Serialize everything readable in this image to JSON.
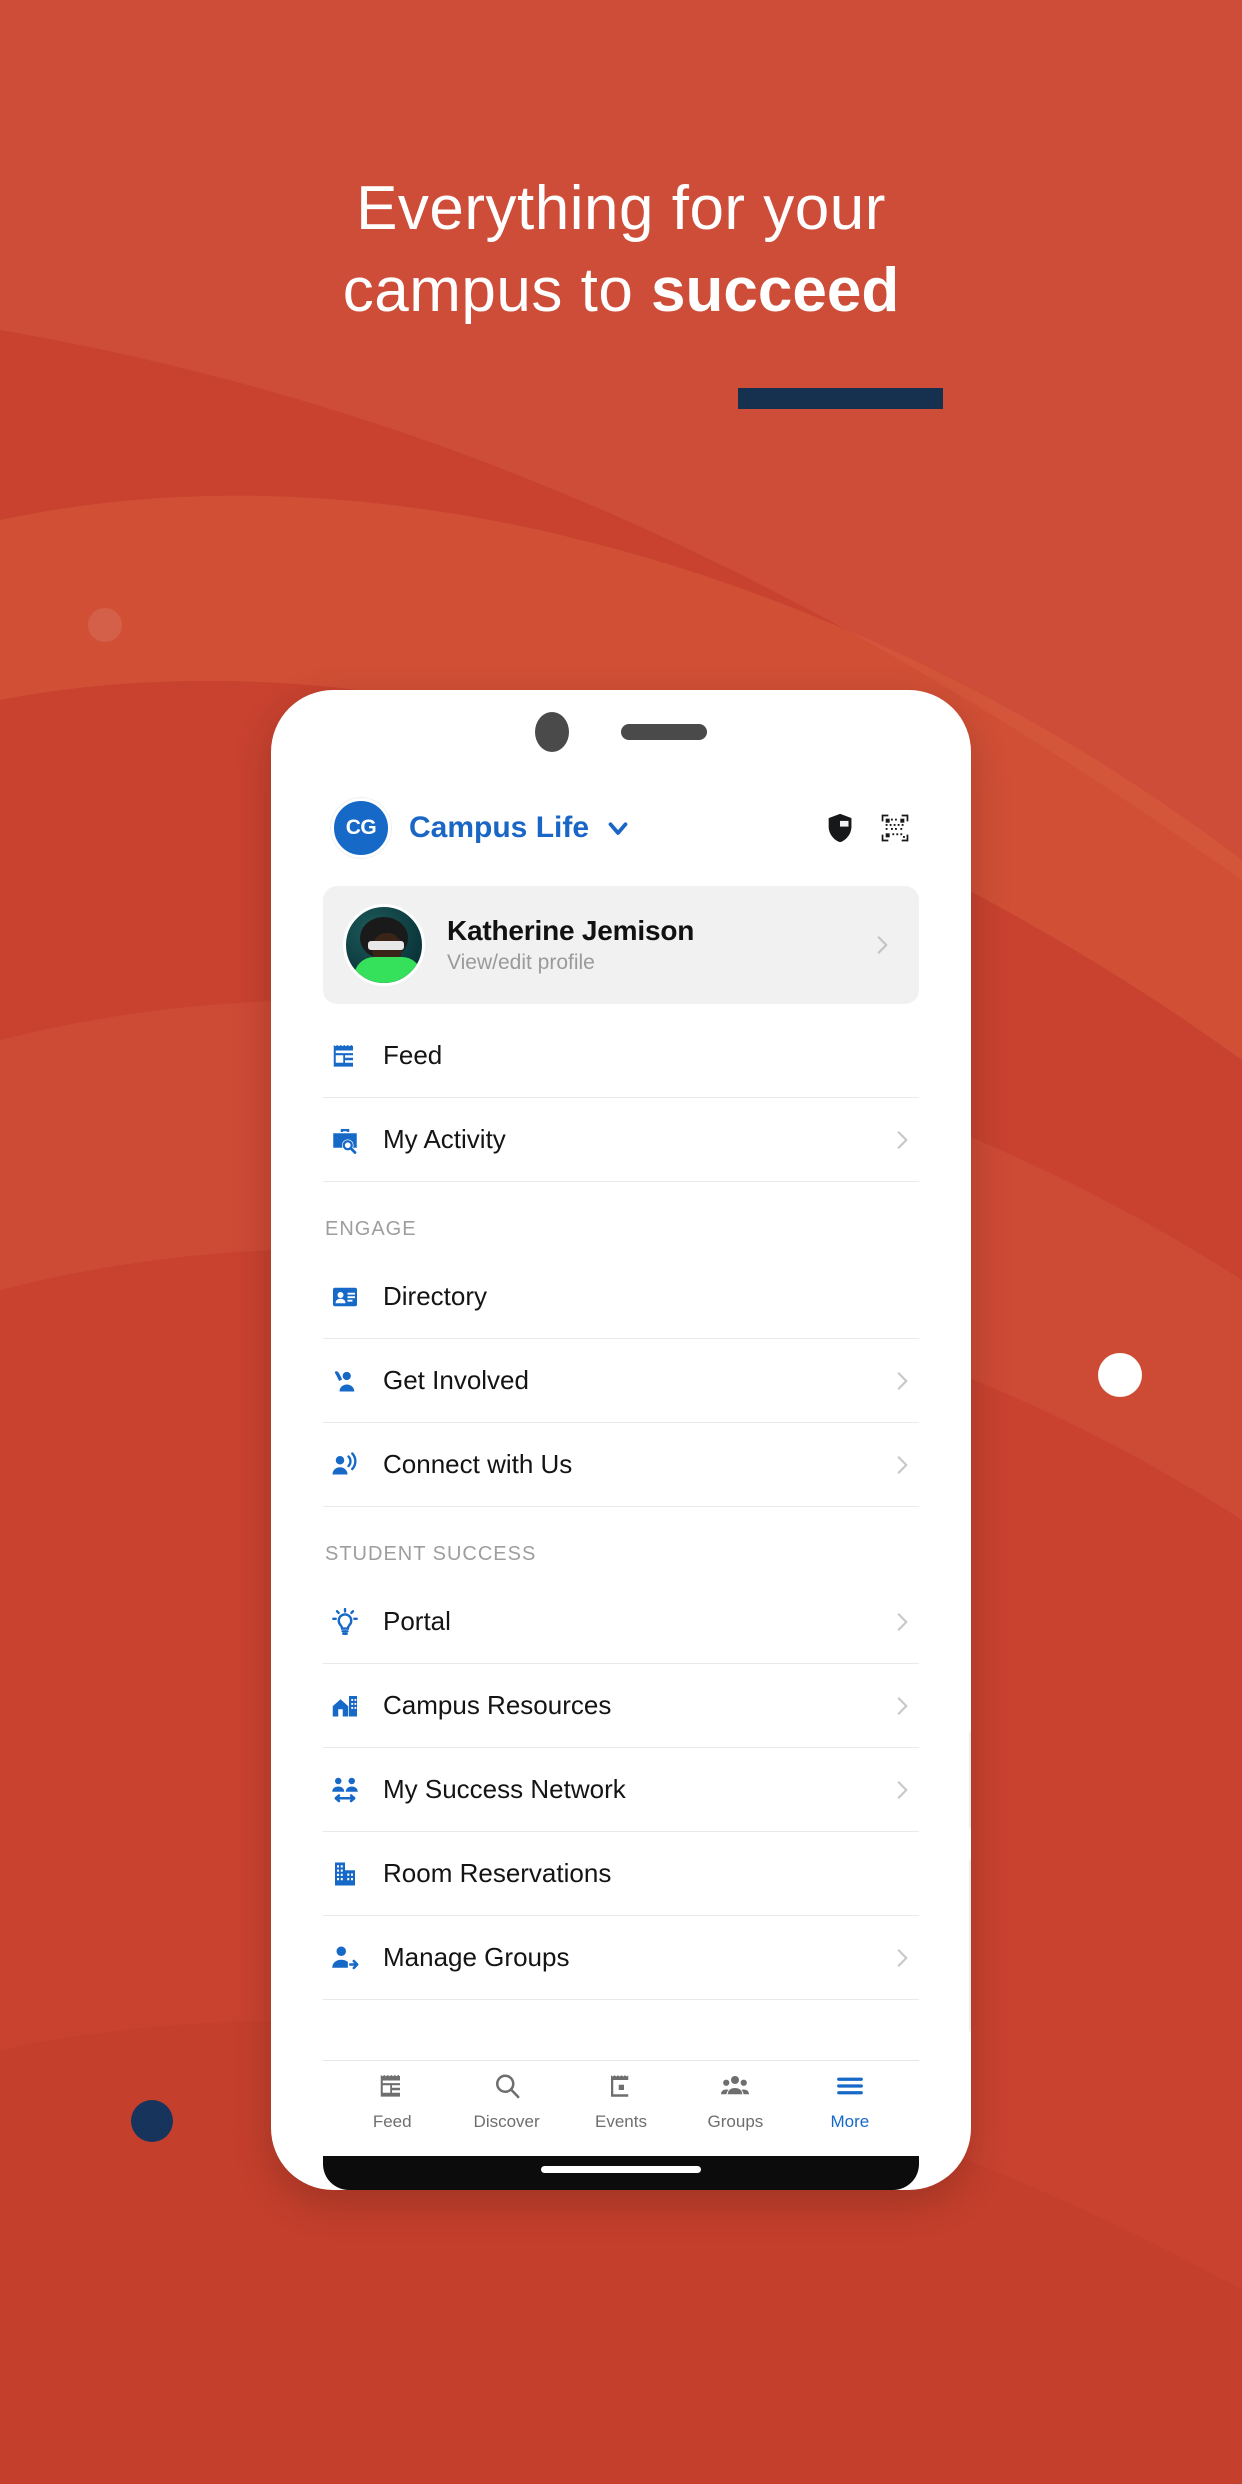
{
  "hero": {
    "line1": "Everything for your",
    "line2_plain": "campus to ",
    "line2_bold": "succeed",
    "accent_color": "#16304f",
    "background_color": "#c8422f"
  },
  "phone": {
    "header": {
      "logo_text": "CG",
      "org_name": "Campus Life",
      "chevron_icon": "chevron-down-icon",
      "shield_icon": "shield-icon",
      "qr_icon": "qr-code-icon"
    },
    "profile": {
      "name": "Katherine Jemison",
      "subtitle": "View/edit profile",
      "avatar_icon": "user-avatar"
    },
    "menu_sections": [
      {
        "label": "",
        "items": [
          {
            "label": "Feed",
            "icon": "feed-icon",
            "chevron": false
          },
          {
            "label": "My Activity",
            "icon": "briefcase-search-icon",
            "chevron": true
          }
        ]
      },
      {
        "label": "ENGAGE",
        "items": [
          {
            "label": "Directory",
            "icon": "contact-card-icon",
            "chevron": false
          },
          {
            "label": "Get Involved",
            "icon": "raised-hand-person-icon",
            "chevron": true
          },
          {
            "label": "Connect with Us",
            "icon": "person-broadcast-icon",
            "chevron": true
          }
        ]
      },
      {
        "label": "STUDENT SUCCESS",
        "items": [
          {
            "label": "Portal",
            "icon": "lightbulb-icon",
            "chevron": true
          },
          {
            "label": "Campus Resources",
            "icon": "campus-building-icon",
            "chevron": true
          },
          {
            "label": "My Success Network",
            "icon": "people-network-icon",
            "chevron": true
          },
          {
            "label": "Room Reservations",
            "icon": "office-building-icon",
            "chevron": false
          },
          {
            "label": "Manage Groups",
            "icon": "person-add-icon",
            "chevron": true
          }
        ]
      }
    ],
    "tabs": [
      {
        "label": "Feed",
        "icon": "feed-icon",
        "active": false
      },
      {
        "label": "Discover",
        "icon": "search-icon",
        "active": false
      },
      {
        "label": "Events",
        "icon": "calendar-icon",
        "active": false
      },
      {
        "label": "Groups",
        "icon": "people-icon",
        "active": false
      },
      {
        "label": "More",
        "icon": "hamburger-icon",
        "active": true
      }
    ]
  }
}
